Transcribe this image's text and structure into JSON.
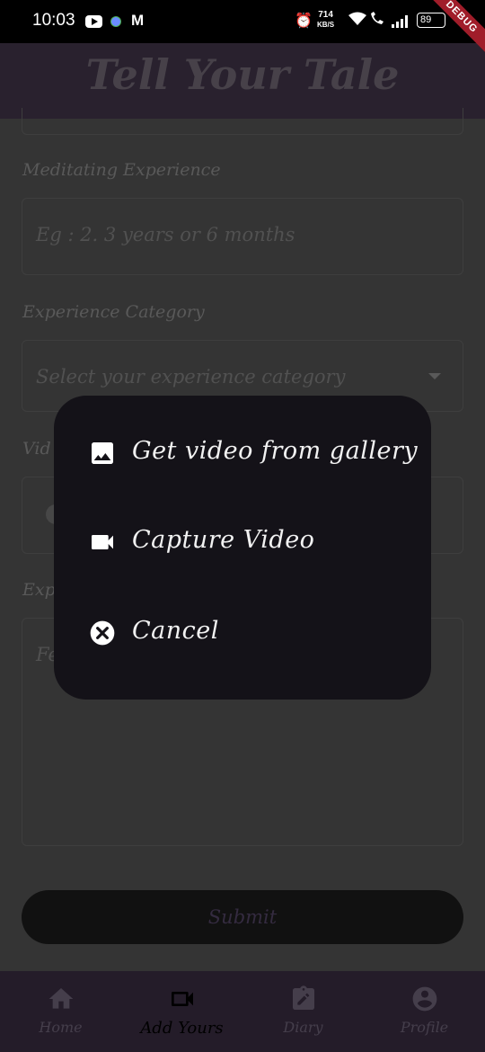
{
  "status_bar": {
    "time": "10:03",
    "gmail_glyph": "M",
    "net_speed_value": "714",
    "net_speed_unit": "KB/S",
    "battery": "89",
    "debug_ribbon": "DEBUG"
  },
  "app_bar": {
    "title": "Tell Your Tale"
  },
  "form": {
    "meditating_experience_label": "Meditating Experience",
    "meditating_experience_placeholder": "Eg : 2. 3 years or 6 months",
    "experience_category_label": "Experience Category",
    "experience_category_placeholder": "Select your experience category",
    "video_label_partial": "Vid",
    "experience_label_partial": "Exp",
    "experience_placeholder_partial": "Fe",
    "submit_label": "Submit"
  },
  "dialog": {
    "options": [
      {
        "label": "Get video from gallery",
        "icon": "image-icon"
      },
      {
        "label": "Capture Video",
        "icon": "videocam-icon"
      },
      {
        "label": "Cancel",
        "icon": "cancel-circle-icon"
      }
    ]
  },
  "bottom_nav": {
    "items": [
      {
        "label": "Home",
        "icon": "home-icon"
      },
      {
        "label": "Add Yours",
        "icon": "videocam-outline-icon"
      },
      {
        "label": "Diary",
        "icon": "clipboard-edit-icon"
      },
      {
        "label": "Profile",
        "icon": "account-circle-icon"
      }
    ],
    "active_index": 1
  },
  "colors": {
    "app_bar": "#473a50",
    "bottom_nav": "#3e3148",
    "dialog_bg": "#141218",
    "submit_bg": "#1e1e1e"
  }
}
